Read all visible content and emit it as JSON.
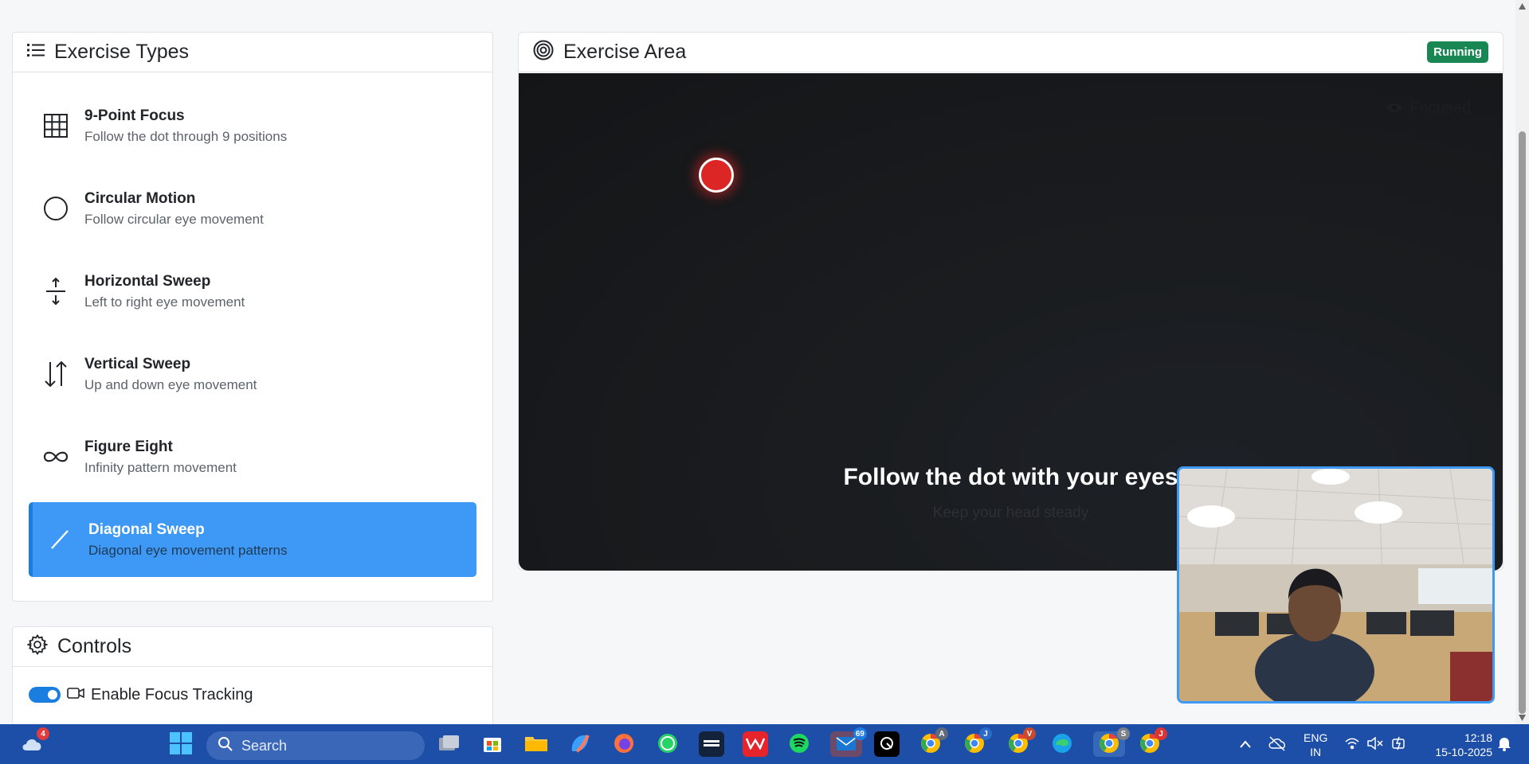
{
  "exercise_types": {
    "title": "Exercise Types",
    "items": [
      {
        "name": "9-Point Focus",
        "desc": "Follow the dot through 9 positions",
        "icon": "grid-icon",
        "active": false
      },
      {
        "name": "Circular Motion",
        "desc": "Follow circular eye movement",
        "icon": "circle-icon",
        "active": false
      },
      {
        "name": "Horizontal Sweep",
        "desc": "Left to right eye movement",
        "icon": "expand-vertical-icon",
        "active": false
      },
      {
        "name": "Vertical Sweep",
        "desc": "Up and down eye movement",
        "icon": "arrow-up-down-icon",
        "active": false
      },
      {
        "name": "Figure Eight",
        "desc": "Infinity pattern movement",
        "icon": "infinity-icon",
        "active": false
      },
      {
        "name": "Diagonal Sweep",
        "desc": "Diagonal eye movement patterns",
        "icon": "slash-icon",
        "active": true
      }
    ]
  },
  "controls": {
    "title": "Controls",
    "focus_tracking_label": "Enable Focus Tracking",
    "focus_tracking_on": true
  },
  "exercise_area": {
    "title": "Exercise Area",
    "status_badge": "Running",
    "focus_status": "Focused",
    "instruction": "Follow the dot with your eyes",
    "sub_instruction": "Keep your head steady"
  },
  "taskbar": {
    "search_placeholder": "Search",
    "weather_badge": "4",
    "app_badges": {
      "outlook": "69",
      "chrome1": "A",
      "chrome2": "J",
      "chrome3": "V",
      "chrome4": "S",
      "chrome5": "J"
    },
    "lang_line1": "ENG",
    "lang_line2": "IN",
    "time": "12:18",
    "date": "15-10-2025"
  },
  "colors": {
    "accent": "#3d99f5",
    "running": "#198754",
    "dot": "#dc2626",
    "taskbar": "#1d4fa8"
  }
}
